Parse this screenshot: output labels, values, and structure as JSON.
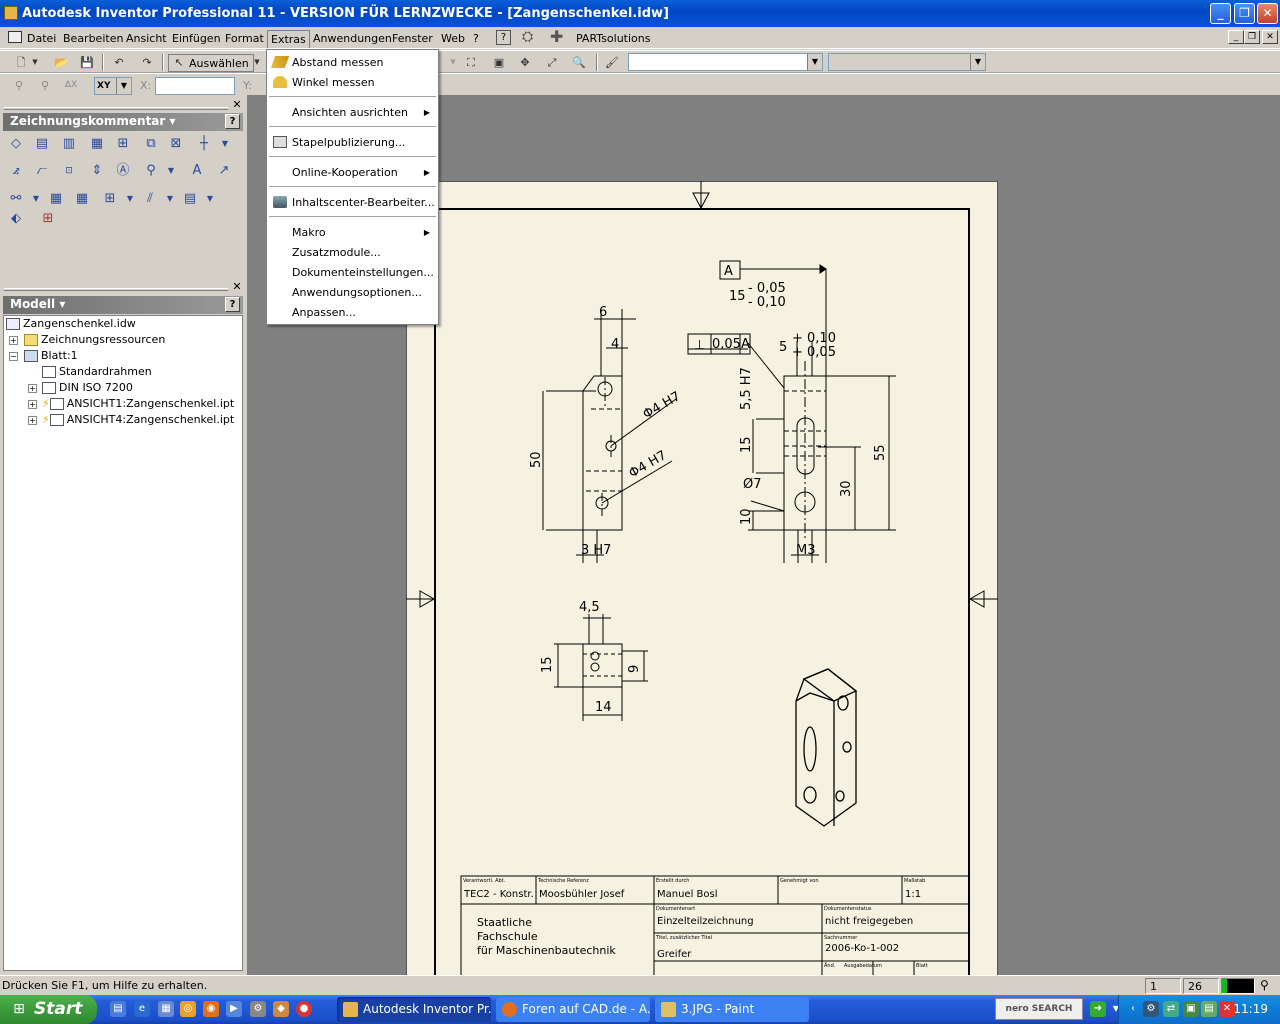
{
  "window": {
    "title": "Autodesk Inventor Professional 11 - VERSION FÜR LERNZWECKE - [Zangenschenkel.idw]"
  },
  "menubar": {
    "items": [
      "Datei",
      "Bearbeiten",
      "Ansicht",
      "Einfügen",
      "Format",
      "Extras",
      "Anwendungen",
      "Fenster",
      "Web",
      "?"
    ],
    "partsolutions": "PARTsolutions"
  },
  "toolbar": {
    "select_label": "Auswählen",
    "xy_label": "XY",
    "x_label": "X:",
    "y_label": "Y:"
  },
  "panels": {
    "annotation_title": "Zeichnungskommentar",
    "model_title": "Modell"
  },
  "tree": {
    "root": "Zangenschenkel.idw",
    "resources": "Zeichnungsressourcen",
    "sheet": "Blatt:1",
    "frame": "Standardrahmen",
    "titleblock": "DIN ISO 7200",
    "view1": "ANSICHT1:Zangenschenkel.ipt",
    "view4": "ANSICHT4:Zangenschenkel.ipt"
  },
  "extras_menu": {
    "items": [
      "Abstand messen",
      "Winkel messen",
      "Ansichten ausrichten",
      "Stapelpublizierung...",
      "Online-Kooperation",
      "Inhaltscenter-Bearbeiter...",
      "Makro",
      "Zusatzmodule...",
      "Dokumenteinstellungen...",
      "Anwendungsoptionen...",
      "Anpassen..."
    ]
  },
  "drawing": {
    "dims": {
      "d6": "6",
      "d4": "4",
      "d50": "50",
      "d3h7": "3 H7",
      "phi4h7a": "Φ4 H7",
      "phi4h7b": "Φ4 H7",
      "datum": "A",
      "tol15": "15",
      "tol15a": "- 0,05",
      "tol15b": "- 0,10",
      "perp_val": "0,05",
      "perp_ref": "A",
      "d5": "5",
      "tol5a": "+ 0,10",
      "tol5b": "+ 0,05",
      "d55h7": "5,5 H7",
      "d15v": "15",
      "d55": "55",
      "phi7": "Ø7",
      "d30": "30",
      "d10": "10",
      "m3": "M3",
      "d45": "4,5",
      "d15b": "15",
      "d9": "9",
      "d14": "14"
    },
    "titleblock": {
      "lbl_resp": "Verantwortl. Abt.",
      "resp": "TEC2 - Konstr.",
      "lbl_tech": "Technische Referenz",
      "tech": "Moosbühler Josef",
      "lbl_made": "Erstellt durch",
      "made": "Manuel Bosl",
      "lbl_approved": "Genehmigt von",
      "lbl_scale": "Maßstab",
      "scale": "1:1",
      "school1": "Staatliche",
      "school2": "Fachschule",
      "school3": "für Maschinenbautechnik",
      "lbl_doctype": "Dokumentenart",
      "doctype": "Einzelteilzeichnung",
      "lbl_docstatus": "Dokumentenstatus",
      "docstatus": "nicht freigegeben",
      "lbl_title": "Titel, zusätzlicher Titel",
      "title": "Greifer",
      "lbl_number": "Sachnummer",
      "number": "2006-Ko-1-002",
      "lbl_change": "Änd.",
      "lbl_date": "Ausgabedatum",
      "lbl_sheet": "Blatt"
    }
  },
  "status": {
    "hint": "Drücken Sie F1, um Hilfe zu erhalten.",
    "field1": "1",
    "field2": "26"
  },
  "taskbar": {
    "start": "Start",
    "tasks": [
      "Autodesk Inventor Pr...",
      "Foren auf CAD.de - A...",
      "3.JPG - Paint"
    ],
    "nero": "nero SEARCH",
    "clock": "11:19"
  }
}
